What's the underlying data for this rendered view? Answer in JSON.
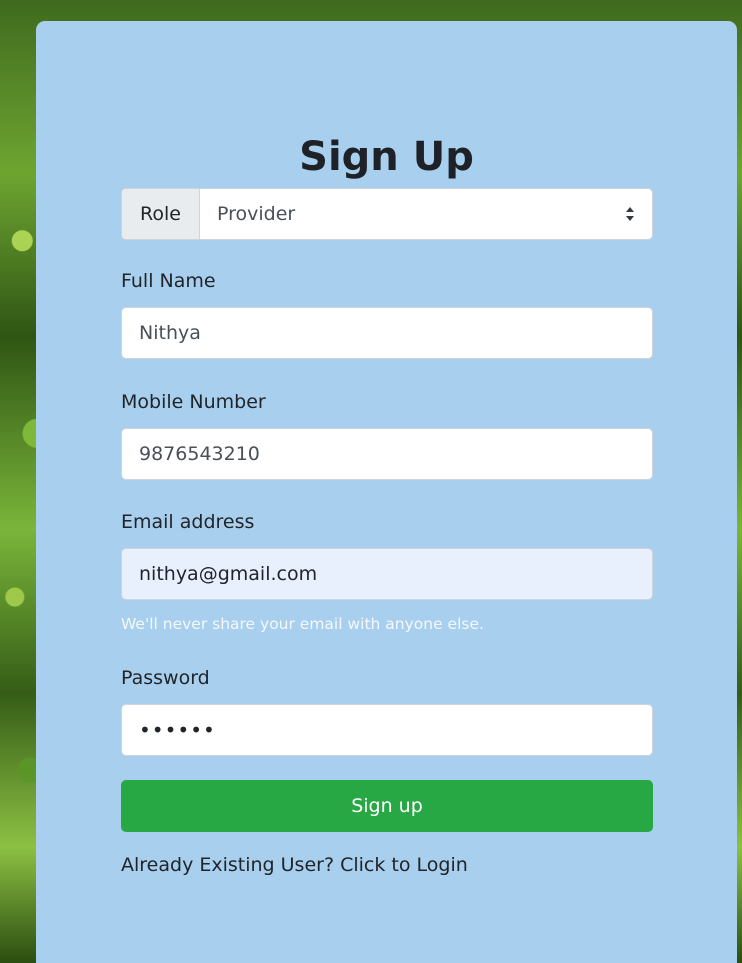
{
  "form": {
    "title": "Sign Up",
    "role": {
      "addon_label": "Role",
      "selected": "Provider"
    },
    "full_name": {
      "label": "Full Name",
      "value": "Nithya"
    },
    "mobile": {
      "label": "Mobile Number",
      "value": "9876543210"
    },
    "email": {
      "label": "Email address",
      "value": "nithya@gmail.com",
      "help": "We'll never share your email with anyone else."
    },
    "password": {
      "label": "Password",
      "value": "••••••"
    },
    "submit_label": "Sign up",
    "login_link": "Already Existing User? Click to Login"
  },
  "colors": {
    "card_bg": "#a8cfee",
    "button_bg": "#28a745",
    "autofill_bg": "#e8f0fe"
  },
  "icons": {
    "select_arrow": "select-arrows-icon"
  }
}
